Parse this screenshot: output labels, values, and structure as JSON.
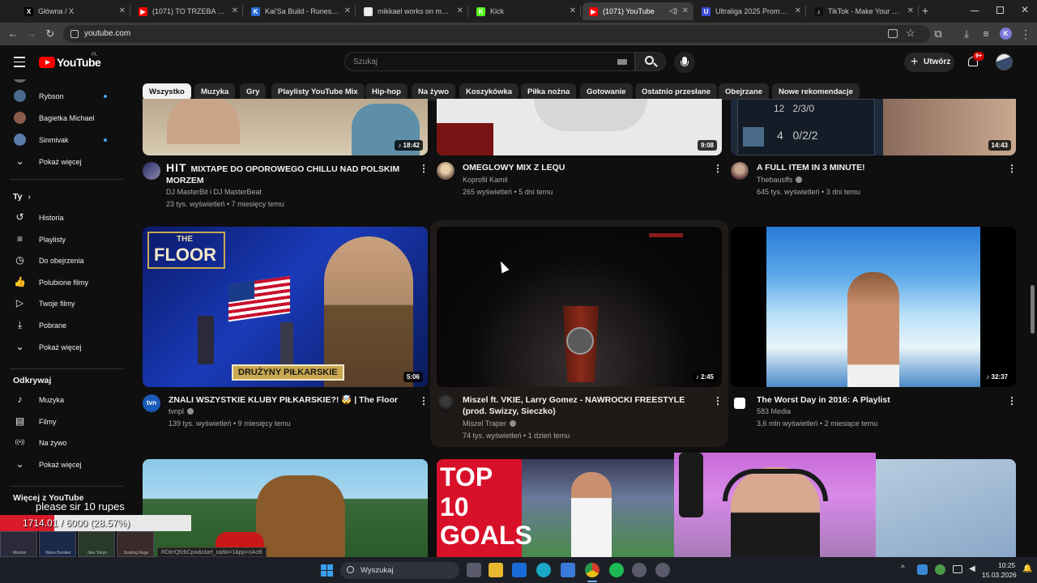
{
  "browser": {
    "tabs": [
      {
        "title": "Główna / X",
        "fav_color": "#000000",
        "fav_char": "X"
      },
      {
        "title": "(1071) TO TRZEBA MIEĆ...",
        "fav_color": "#ff0000",
        "fav_char": "▶"
      },
      {
        "title": "Kai'Sa Build - Runes & Ite",
        "fav_color": "#2b6ad8",
        "fav_char": "K"
      },
      {
        "title": "mikkael works on malzah",
        "fav_color": "#e8e8e8",
        "fav_char": "G"
      },
      {
        "title": "Kick",
        "fav_color": "#53fc18",
        "fav_char": "K"
      },
      {
        "title": "(1071) YouTube",
        "fav_color": "#ff0000",
        "fav_char": "▶"
      },
      {
        "title": "Ultraliga 2025 Promotion",
        "fav_color": "#3a4bd8",
        "fav_char": "U"
      },
      {
        "title": "TikTok - Make Your Day",
        "fav_color": "#111111",
        "fav_char": "♪"
      }
    ],
    "new_tab": "+",
    "url": "youtube.com",
    "profile_initial": "K"
  },
  "masthead": {
    "logo_text": "YouTube",
    "region": "PL",
    "search_placeholder": "Szukaj",
    "create_label": "Utwórz",
    "notif_count": "9+"
  },
  "chips": [
    "Wszystko",
    "Muzyka",
    "Gry",
    "Playlisty YouTube Mix",
    "Hip-hop",
    "Na żywo",
    "Koszykówka",
    "Piłka nożna",
    "Gotowanie",
    "Ostatnio przesłane",
    "Obejrzane",
    "Nowe rekomendacje"
  ],
  "sidebar": {
    "subs": [
      {
        "label": "Rybson",
        "color": "#4a6a8a",
        "live": true
      },
      {
        "label": "Bagietka Michael",
        "color": "#8a5a4a",
        "live": false
      },
      {
        "label": "Sinmivak",
        "color": "#5a7aa8",
        "live": true
      }
    ],
    "show_more": "Pokaż więcej",
    "you_heading": "Ty",
    "you_items": [
      "Historia",
      "Playlisty",
      "Do obejrzenia",
      "Polubione filmy",
      "Twoje filmy",
      "Pobrane",
      "Pokaż więcej"
    ],
    "explore_heading": "Odkrywaj",
    "explore_items": [
      "Muzyka",
      "Filmy",
      "Na żywo",
      "Pokaż więcej"
    ],
    "more_heading": "Więcej z YouTube"
  },
  "videos_row1": [
    {
      "title": "MIXTAPE DO OPOROWEGO CHILLU NAD POLSKIM MORZEM",
      "prefix": "HIT",
      "channel": "DJ MasterBit i DJ MasterBeat",
      "meta": "23 tys. wyświetleń • 7 miesięcy temu",
      "duration": "18:42",
      "verified": false
    },
    {
      "title": "OMEGLOWY MIX Z LEQU",
      "channel": "Koprofil Kamil",
      "meta": "265 wyświetleń • 5 dni temu",
      "duration": "9:08",
      "verified": false
    },
    {
      "title": "A FULL ITEM IN 3 MINUTE!",
      "channel": "Thebausffs",
      "meta": "645 tys. wyświetleń • 3 dni temu",
      "duration": "14:43",
      "verified": true,
      "hud_row1": "12   2/3/0",
      "hud_row2": "4   0/2/2"
    }
  ],
  "videos_row2": [
    {
      "title": "ZNALI WSZYSTKIE KLUBY PIŁKARSKIE?! 🤯 | The Floor",
      "channel": "tvnpl",
      "meta": "139 tys. wyświetleń • 9 miesięcy temu",
      "duration": "5:06",
      "verified": true,
      "thumb_text": "DRUŻYNY PIŁKARSKIE",
      "logo_line1": "THE",
      "logo_line2": "FLOOR",
      "avatar_text": "tvn"
    },
    {
      "title": "Miszel ft. VKIE, Larry Gomez - NAWROCKI FREESTYLE (prod. Swizzy, Sieczko)",
      "channel": "Miszel Traper",
      "meta": "74 tys. wyświetleń • 1 dzień temu",
      "duration": "2:45",
      "verified": true
    },
    {
      "title": "The Worst Day in 2016: A Playlist",
      "channel": "583 Media",
      "meta": "3,6 mln wyświetleń • 2 miesiące temu",
      "duration": "32:37",
      "verified": false
    }
  ],
  "row3": {
    "top10_line1": "TOP 10",
    "top10_line2": "GOALS"
  },
  "overlay": {
    "donation_text": "please sir 10 rupes",
    "progress_text": "1714.01 / 6000 (28.57%)",
    "progress_fraction": 0.2857,
    "tiles": [
      "Weston",
      "Wave Breaker",
      "Neo Tokyo",
      "Soaring Rage"
    ]
  },
  "status_url": "RDtrrQfzbCpw&start_radio=1&pp=oAcB",
  "taskbar": {
    "search_label": "Wyszukaj",
    "time": "10:25",
    "date": "15.03.2026"
  }
}
